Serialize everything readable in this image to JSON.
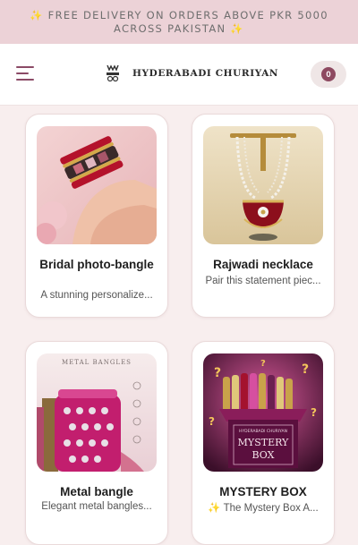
{
  "promo": {
    "text": "✨ FREE DELIVERY ON ORDERS ABOVE PKR 5000 ACROSS PAKISTAN ✨"
  },
  "header": {
    "brand": "HYDERABADI CHURIYAN",
    "cart_count": "0"
  },
  "products": [
    {
      "title": "Bridal photo-bangle",
      "description": "A stunning personalize..."
    },
    {
      "title": "Rajwadi necklace",
      "description": "Pair this statement piec..."
    },
    {
      "title": "Metal bangle",
      "description": "Elegant metal bangles..."
    },
    {
      "title": "MYSTERY BOX",
      "description": "✨ The Mystery Box A..."
    }
  ],
  "image_text": {
    "metal_banner": "METAL BANGLES",
    "box_top": "HYDERABADI CHURIYAN",
    "box_mystery": "MYSTERY",
    "box_box": "BOX"
  },
  "colors": {
    "accent": "#8e4a61",
    "promo_bg": "#ecd2d7",
    "page_bg": "#f8eeee"
  }
}
